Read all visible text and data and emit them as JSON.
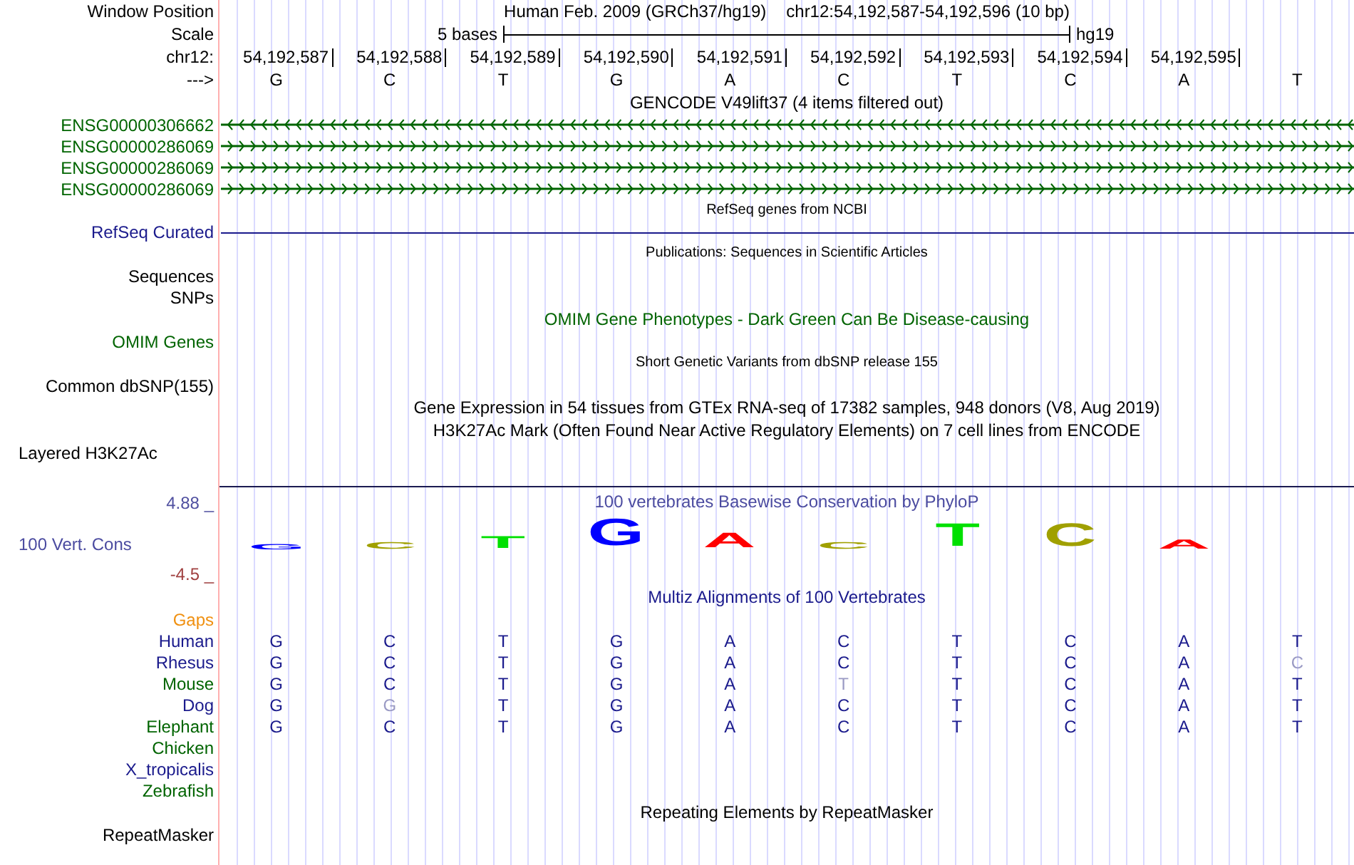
{
  "rows": [
    {
      "kind": "position",
      "label": "Window Position",
      "assembly": "Human Feb. 2009 (GRCh37/hg19)",
      "region": "chr12:54,192,587-54,192,596 (10 bp)"
    },
    {
      "kind": "scale",
      "label": "Scale",
      "span": "5 bases",
      "build": "hg19"
    },
    {
      "kind": "ruler",
      "label": "chr12:",
      "positions": [
        "54,192,587",
        "54,192,588",
        "54,192,589",
        "54,192,590",
        "54,192,591",
        "54,192,592",
        "54,192,593",
        "54,192,594",
        "54,192,595"
      ]
    },
    {
      "kind": "bases",
      "label": "--->",
      "bases": [
        "G",
        "C",
        "T",
        "G",
        "A",
        "C",
        "T",
        "C",
        "A",
        "T"
      ]
    },
    {
      "kind": "title",
      "text": "GENCODE V49lift37 (4 items filtered out)",
      "color": "#000000"
    },
    {
      "kind": "gene",
      "label": "ENSG00000306662",
      "color": "#006400",
      "reverse": true
    },
    {
      "kind": "gene",
      "label": "ENSG00000286069",
      "color": "#006400",
      "reverse": false
    },
    {
      "kind": "gene",
      "label": "ENSG00000286069",
      "color": "#006400",
      "reverse": false
    },
    {
      "kind": "gene",
      "label": "ENSG00000286069",
      "color": "#006400",
      "reverse": false
    },
    {
      "kind": "note",
      "text": "RefSeq genes from NCBI",
      "color": "#000000"
    },
    {
      "kind": "line",
      "label": "RefSeq Curated",
      "color": "#1a1a8c"
    },
    {
      "kind": "note",
      "text": "Publications: Sequences in Scientific Articles",
      "color": "#000000"
    },
    {
      "kind": "label",
      "label": "Sequences",
      "color": "#000000"
    },
    {
      "kind": "label",
      "label": "SNPs",
      "color": "#000000"
    },
    {
      "kind": "title",
      "text": "OMIM Gene Phenotypes - Dark Green Can Be Disease-causing",
      "color": "#006400"
    },
    {
      "kind": "label",
      "label": "OMIM Genes",
      "color": "#006400"
    },
    {
      "kind": "note",
      "text": "Short Genetic Variants from dbSNP release 155",
      "color": "#000000"
    },
    {
      "kind": "label",
      "label": "Common dbSNP(155)",
      "color": "#000000"
    },
    {
      "kind": "title",
      "text": "Gene Expression in 54 tissues from GTEx RNA-seq of 17382 samples, 948 donors (V8, Aug 2019)",
      "color": "#000000"
    },
    {
      "kind": "title",
      "text": "H3K27Ac Mark (Often Found Near Active Regulatory Elements) on 7 cell lines from ENCODE",
      "color": "#000000"
    },
    {
      "kind": "composite",
      "label": "Layered H3K27Ac",
      "color": "#000000"
    },
    {
      "kind": "conservation",
      "label": "100 Vert. Cons",
      "max": "4.88 _",
      "min": "-4.5 _",
      "title": "100 vertebrates Basewise Conservation by PhyloP",
      "logo": [
        {
          "base": "G",
          "color": "#0000ff"
        },
        {
          "base": "C",
          "color": "#a0a000"
        },
        {
          "base": "T",
          "color": "#00e000"
        },
        {
          "base": "G",
          "color": "#0000ff"
        },
        {
          "base": "A",
          "color": "#ff0000"
        },
        {
          "base": "C",
          "color": "#a0a000"
        },
        {
          "base": "T",
          "color": "#00e000"
        },
        {
          "base": "C",
          "color": "#a0a000"
        },
        {
          "base": "A",
          "color": "#ff0000"
        }
      ]
    },
    {
      "kind": "title",
      "text": "Multiz Alignments of 100 Vertebrates",
      "color": "#1a1a8c"
    },
    {
      "kind": "label",
      "label": "Gaps",
      "color": "#f09010"
    },
    {
      "kind": "alignment",
      "label": "Human",
      "color": "#1a1a8c",
      "bases": [
        {
          "base": "G",
          "mismatch": false
        },
        {
          "base": "C",
          "mismatch": false
        },
        {
          "base": "T",
          "mismatch": false
        },
        {
          "base": "G",
          "mismatch": false
        },
        {
          "base": "A",
          "mismatch": false
        },
        {
          "base": "C",
          "mismatch": false
        },
        {
          "base": "T",
          "mismatch": false
        },
        {
          "base": "C",
          "mismatch": false
        },
        {
          "base": "A",
          "mismatch": false
        },
        {
          "base": "T",
          "mismatch": false
        }
      ]
    },
    {
      "kind": "alignment",
      "label": "Rhesus",
      "color": "#1a1a8c",
      "bases": [
        {
          "base": "G",
          "mismatch": false
        },
        {
          "base": "C",
          "mismatch": false
        },
        {
          "base": "T",
          "mismatch": false
        },
        {
          "base": "G",
          "mismatch": false
        },
        {
          "base": "A",
          "mismatch": false
        },
        {
          "base": "C",
          "mismatch": false
        },
        {
          "base": "T",
          "mismatch": false
        },
        {
          "base": "C",
          "mismatch": false
        },
        {
          "base": "A",
          "mismatch": false
        },
        {
          "base": "C",
          "mismatch": true
        }
      ]
    },
    {
      "kind": "alignment",
      "label": "Mouse",
      "color": "#006400",
      "bases": [
        {
          "base": "G",
          "mismatch": false
        },
        {
          "base": "C",
          "mismatch": false
        },
        {
          "base": "T",
          "mismatch": false
        },
        {
          "base": "G",
          "mismatch": false
        },
        {
          "base": "A",
          "mismatch": false
        },
        {
          "base": "T",
          "mismatch": true
        },
        {
          "base": "T",
          "mismatch": false
        },
        {
          "base": "C",
          "mismatch": false
        },
        {
          "base": "A",
          "mismatch": false
        },
        {
          "base": "T",
          "mismatch": false
        }
      ]
    },
    {
      "kind": "alignment",
      "label": "Dog",
      "color": "#1a1a8c",
      "bases": [
        {
          "base": "G",
          "mismatch": false
        },
        {
          "base": "G",
          "mismatch": true
        },
        {
          "base": "T",
          "mismatch": false
        },
        {
          "base": "G",
          "mismatch": false
        },
        {
          "base": "A",
          "mismatch": false
        },
        {
          "base": "C",
          "mismatch": false
        },
        {
          "base": "T",
          "mismatch": false
        },
        {
          "base": "C",
          "mismatch": false
        },
        {
          "base": "A",
          "mismatch": false
        },
        {
          "base": "T",
          "mismatch": false
        }
      ]
    },
    {
      "kind": "alignment",
      "label": "Elephant",
      "color": "#006400",
      "bases": [
        {
          "base": "G",
          "mismatch": false
        },
        {
          "base": "C",
          "mismatch": false
        },
        {
          "base": "T",
          "mismatch": false
        },
        {
          "base": "G",
          "mismatch": false
        },
        {
          "base": "A",
          "mismatch": false
        },
        {
          "base": "C",
          "mismatch": false
        },
        {
          "base": "T",
          "mismatch": false
        },
        {
          "base": "C",
          "mismatch": false
        },
        {
          "base": "A",
          "mismatch": false
        },
        {
          "base": "T",
          "mismatch": false
        }
      ]
    },
    {
      "kind": "label",
      "label": "Chicken",
      "color": "#006400"
    },
    {
      "kind": "label",
      "label": "X_tropicalis",
      "color": "#1a1a8c"
    },
    {
      "kind": "label",
      "label": "Zebrafish",
      "color": "#006400"
    },
    {
      "kind": "title",
      "text": "Repeating Elements by RepeatMasker",
      "color": "#000000"
    },
    {
      "kind": "label",
      "label": "RepeatMasker",
      "color": "#000000"
    }
  ]
}
